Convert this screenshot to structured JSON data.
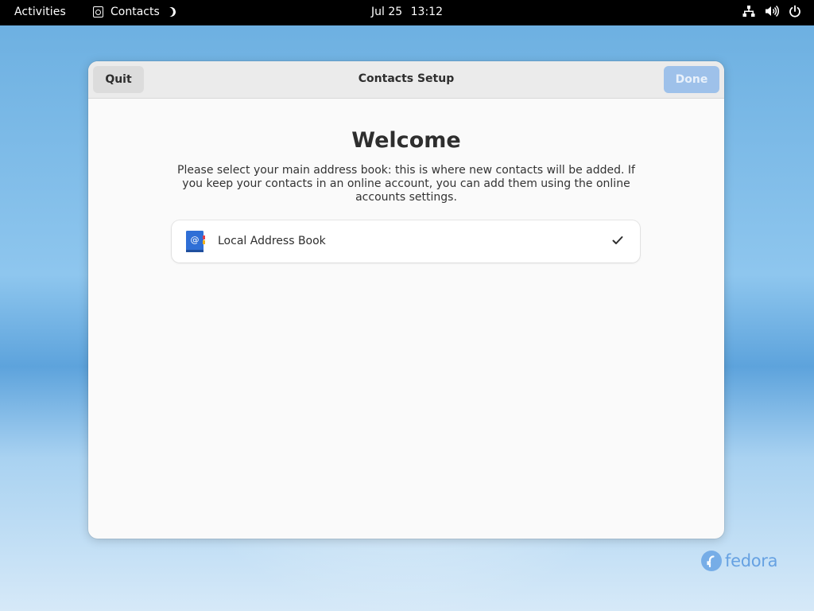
{
  "topbar": {
    "activities": "Activities",
    "app_name": "Contacts",
    "date": "Jul 25",
    "time": "13:12",
    "icons": [
      "network-icon",
      "volume-icon",
      "power-icon"
    ]
  },
  "window": {
    "title": "Contacts Setup",
    "quit_label": "Quit",
    "done_label": "Done",
    "heading": "Welcome",
    "description": "Please select your main address book: this is where new contacts will be added. If you keep your contacts in an online account, you can add them using the online accounts settings.",
    "address_books": [
      {
        "label": "Local Address Book",
        "icon": "address-book-icon",
        "selected": true
      }
    ]
  },
  "desktop": {
    "logo_text": "fedora"
  },
  "colors": {
    "accent_disabled": "#9ec1ea",
    "topbar": "#000000",
    "window_bg": "#fafafa"
  }
}
